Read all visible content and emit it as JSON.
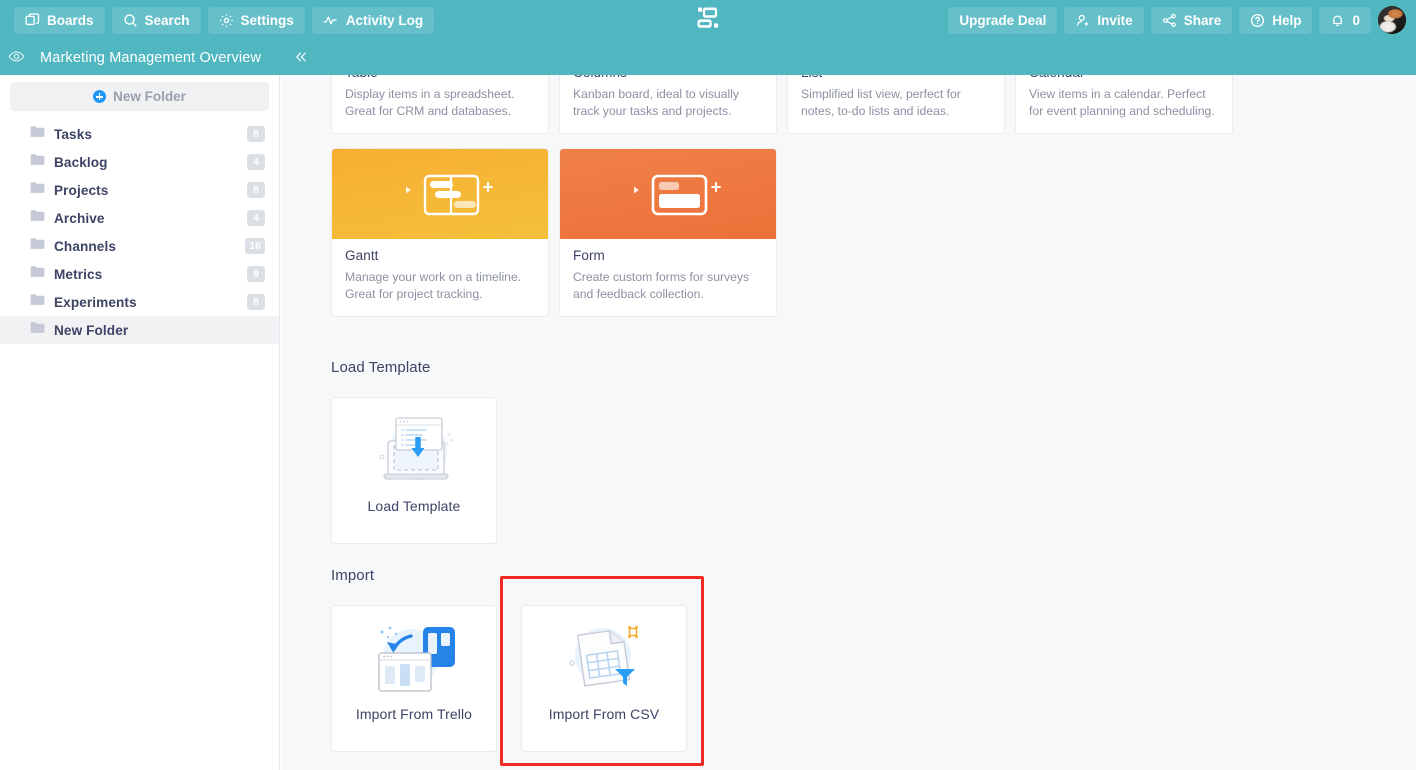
{
  "theme": {
    "header_bg": "#50b7c1",
    "main_bg": "#f7f8fa",
    "text_dark": "#3d4465",
    "text_muted": "#8c91a1",
    "accent_blue": "#2196f3",
    "highlight_red": "#f02b22",
    "gantt_orange": "#f5a623",
    "form_orange": "#ee7c43"
  },
  "topbar": {
    "left_buttons": [
      {
        "label": "Boards",
        "icon": "boards-icon"
      },
      {
        "label": "Search",
        "icon": "search-icon"
      },
      {
        "label": "Settings",
        "icon": "gear-icon"
      },
      {
        "label": "Activity Log",
        "icon": "activity-icon"
      }
    ],
    "logo": "app-logo",
    "right_buttons": [
      {
        "label": "Upgrade Deal",
        "icon": ""
      },
      {
        "label": "Invite",
        "icon": "person-add-icon"
      },
      {
        "label": "Share",
        "icon": "share-icon"
      },
      {
        "label": "Help",
        "icon": "question-circle-icon"
      }
    ],
    "notifications": {
      "icon": "bell-icon",
      "count": "0"
    },
    "avatar": "user-avatar"
  },
  "boardbar": {
    "eye_icon": "eye-icon",
    "title": "Marketing Management Overview",
    "collapse_icon": "«",
    "settings_tab_icon": "gear-icon",
    "add_tab_label": "+"
  },
  "sidebar": {
    "new_folder_label": "New Folder",
    "folders": [
      {
        "name": "Tasks",
        "count": "8",
        "selected": false
      },
      {
        "name": "Backlog",
        "count": "4",
        "selected": false
      },
      {
        "name": "Projects",
        "count": "8",
        "selected": false
      },
      {
        "name": "Archive",
        "count": "4",
        "selected": false
      },
      {
        "name": "Channels",
        "count": "16",
        "selected": false
      },
      {
        "name": "Metrics",
        "count": "9",
        "selected": false
      },
      {
        "name": "Experiments",
        "count": "8",
        "selected": false
      },
      {
        "name": "New Folder",
        "count": "",
        "selected": true
      }
    ]
  },
  "main": {
    "view_types_row1": [
      {
        "title": "Table",
        "desc": "Display items in a spreadsheet. Great for CRM and databases."
      },
      {
        "title": "Columns",
        "desc": "Kanban board, ideal to visually track your tasks and projects."
      },
      {
        "title": "List",
        "desc": "Simplified list view, perfect for notes, to-do lists and ideas."
      },
      {
        "title": "Calendar",
        "desc": "View items in a calendar. Perfect for event planning and scheduling."
      }
    ],
    "view_types_row2": [
      {
        "title": "Gantt",
        "desc": "Manage your work on a timeline. Great for project tracking.",
        "art": "gantt-art"
      },
      {
        "title": "Form",
        "desc": "Create custom forms for surveys and feedback collection.",
        "art": "form-art"
      }
    ],
    "load_template_heading": "Load Template",
    "load_template_tile": {
      "label": "Load Template",
      "icon": "load-template-icon"
    },
    "import_heading": "Import",
    "import_tiles": [
      {
        "label": "Import From Trello",
        "icon": "trello-import-icon",
        "highlighted": false
      },
      {
        "label": "Import From CSV",
        "icon": "csv-import-icon",
        "highlighted": true
      }
    ]
  }
}
